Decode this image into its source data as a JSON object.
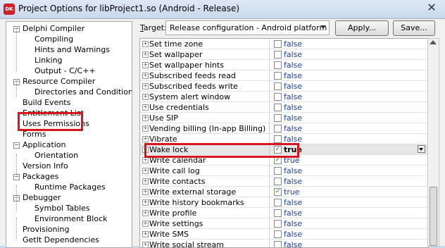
{
  "window": {
    "title": "Project Options for libProject1.so  (Android - Release)",
    "icon_text": "DK",
    "close_glyph": "✕"
  },
  "tree": {
    "items": [
      {
        "label": "Delphi Compiler",
        "expander": "−"
      },
      {
        "label": "Compiling"
      },
      {
        "label": "Hints and Warnings"
      },
      {
        "label": "Linking"
      },
      {
        "label": "Output - C/C++"
      },
      {
        "label": "Resource Compiler",
        "expander": "−"
      },
      {
        "label": "Directories and Conditionals"
      },
      {
        "label": "Build Events"
      },
      {
        "label": "Entitlement List"
      },
      {
        "label": "Uses Permissions"
      },
      {
        "label": "Forms"
      },
      {
        "label": "Application",
        "expander": "−"
      },
      {
        "label": "Orientation"
      },
      {
        "label": "Version Info"
      },
      {
        "label": "Packages",
        "expander": "−"
      },
      {
        "label": "Runtime Packages"
      },
      {
        "label": "Debugger",
        "expander": "−"
      },
      {
        "label": "Symbol Tables"
      },
      {
        "label": "Environment Block"
      },
      {
        "label": "Provisioning"
      },
      {
        "label": "GetIt Dependencies"
      }
    ]
  },
  "toolbar": {
    "target_label_underlined": "T",
    "target_label_rest": "arget:",
    "target_value": "Release configuration - Android platform",
    "apply_label": "Apply...",
    "save_label": "Save..."
  },
  "permissions": {
    "rows": [
      {
        "name": "Set time zone",
        "value": "false",
        "checked": false
      },
      {
        "name": "Set wallpaper",
        "value": "false",
        "checked": false
      },
      {
        "name": "Set wallpaper hints",
        "value": "false",
        "checked": false
      },
      {
        "name": "Subscribed feeds read",
        "value": "false",
        "checked": false
      },
      {
        "name": "Subscribed feeds write",
        "value": "false",
        "checked": false
      },
      {
        "name": "System alert window",
        "value": "false",
        "checked": false
      },
      {
        "name": "Use credentials",
        "value": "false",
        "checked": false
      },
      {
        "name": "Use SIP",
        "value": "false",
        "checked": false
      },
      {
        "name": "Vending billing (In-app Billing)",
        "value": "false",
        "checked": false
      },
      {
        "name": "Vibrate",
        "value": "false",
        "checked": false
      },
      {
        "name": "Wake lock",
        "value": "true",
        "checked": true
      },
      {
        "name": "Write calendar",
        "value": "true",
        "checked": true
      },
      {
        "name": "Write call log",
        "value": "false",
        "checked": false
      },
      {
        "name": "Write contacts",
        "value": "false",
        "checked": false
      },
      {
        "name": "Write external storage",
        "value": "true",
        "checked": true
      },
      {
        "name": "Write history bookmarks",
        "value": "false",
        "checked": false
      },
      {
        "name": "Write profile",
        "value": "false",
        "checked": false
      },
      {
        "name": "Write settings",
        "value": "false",
        "checked": false
      },
      {
        "name": "Write SMS",
        "value": "false",
        "checked": false
      },
      {
        "name": "Write social stream",
        "value": "false",
        "checked": false
      }
    ],
    "check_glyph": "✓"
  },
  "colors": {
    "highlight": "#d8141e",
    "value_text": "#1a3fa3"
  }
}
